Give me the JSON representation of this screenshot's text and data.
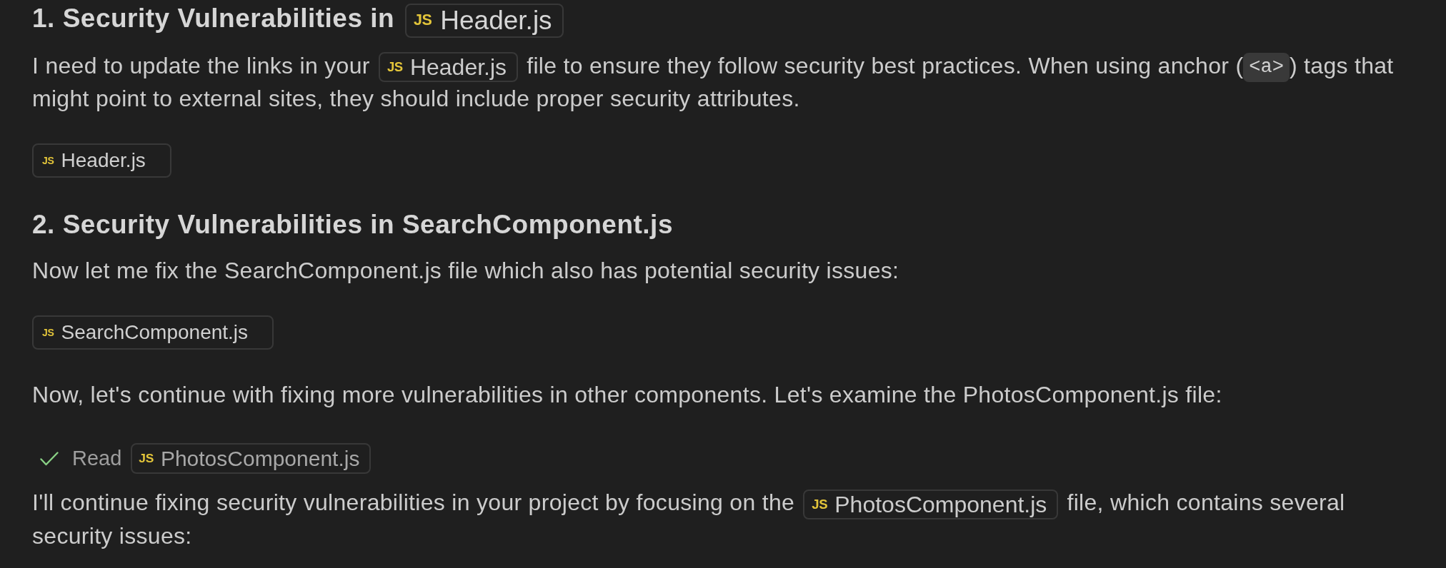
{
  "blocks": [
    {
      "kind": "heading",
      "parts": [
        {
          "kind": "text",
          "text": "1. Security Vulnerabilities in "
        },
        {
          "kind": "file",
          "icon": "JS",
          "name": "Header.js"
        }
      ]
    },
    {
      "kind": "paragraph",
      "parts": [
        {
          "kind": "text",
          "text": "I need to update the links in your "
        },
        {
          "kind": "file",
          "icon": "JS",
          "name": "Header.js"
        },
        {
          "kind": "text",
          "text": " file to ensure they follow security best practices. When using anchor ("
        },
        {
          "kind": "code",
          "text": "<a>"
        },
        {
          "kind": "text",
          "text": ") tags that might point to external sites, they should include proper security attributes."
        }
      ]
    },
    {
      "kind": "file_card",
      "file": {
        "icon": "JS",
        "name": "Header.js"
      }
    },
    {
      "kind": "heading",
      "parts": [
        {
          "kind": "text",
          "text": "2. Security Vulnerabilities in SearchComponent.js"
        }
      ]
    },
    {
      "kind": "paragraph",
      "parts": [
        {
          "kind": "text",
          "text": "Now let me fix the SearchComponent.js file which also has potential security issues:"
        }
      ]
    },
    {
      "kind": "file_card",
      "file": {
        "icon": "JS",
        "name": "SearchComponent.js"
      }
    },
    {
      "kind": "paragraph",
      "parts": [
        {
          "kind": "text",
          "text": "Now, let's continue with fixing more vulnerabilities in other components. Let's examine the PhotosComponent.js file:"
        }
      ]
    },
    {
      "kind": "tool_step",
      "done": true,
      "label": "Read",
      "file": {
        "icon": "JS",
        "name": "PhotosComponent.js"
      }
    },
    {
      "kind": "paragraph",
      "parts": [
        {
          "kind": "text",
          "text": "I'll continue fixing security vulnerabilities in your project by focusing on the "
        },
        {
          "kind": "file",
          "icon": "JS",
          "name": "PhotosComponent.js"
        },
        {
          "kind": "text",
          "text": " file, which contains several security issues:"
        }
      ]
    }
  ]
}
